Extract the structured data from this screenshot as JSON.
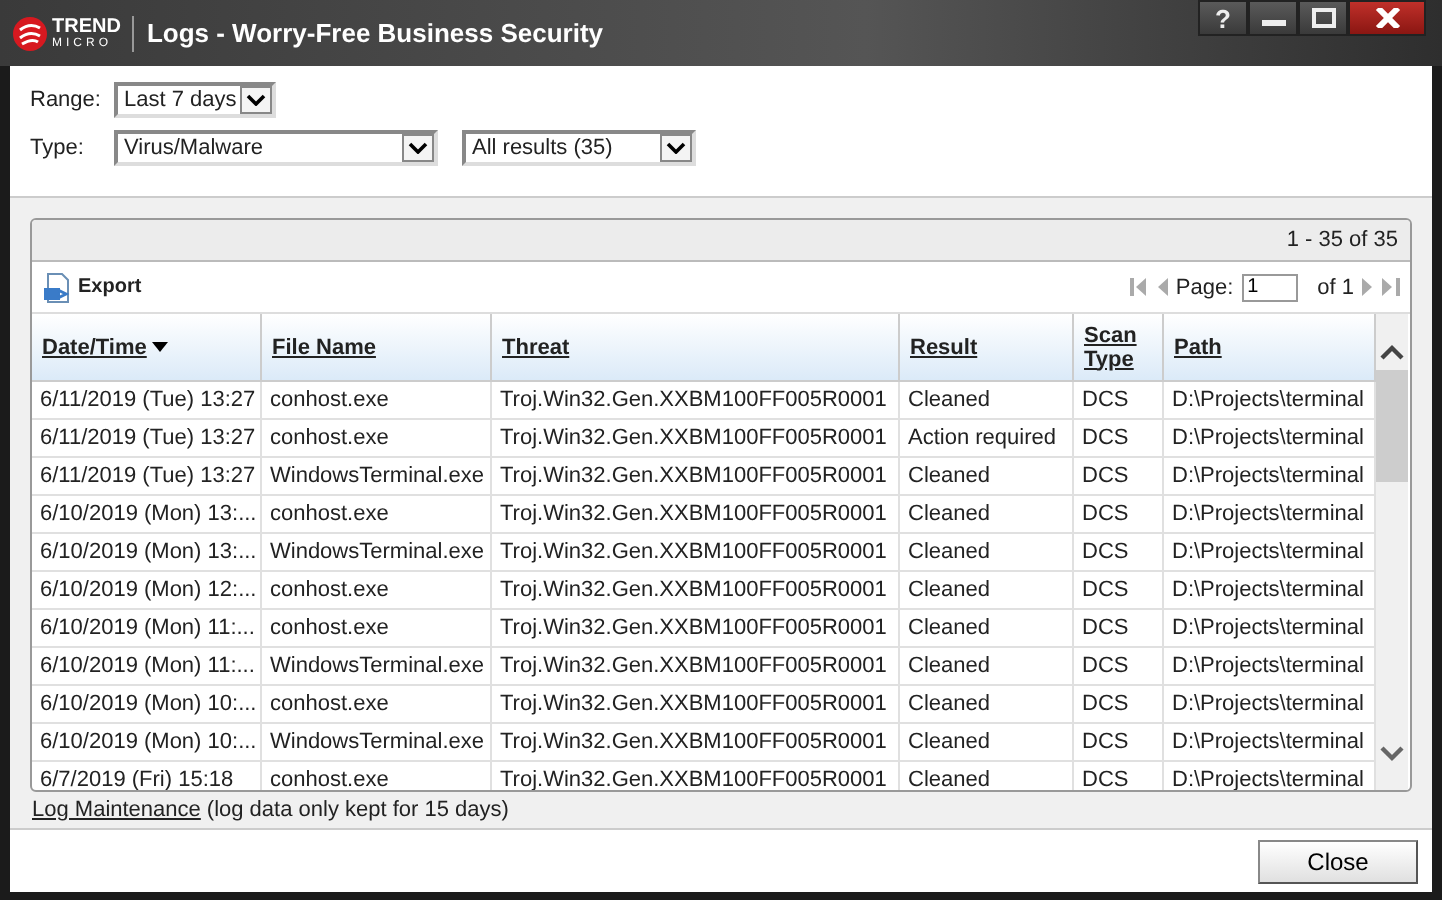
{
  "window": {
    "logo": {
      "line1": "TREND",
      "line2": "MICRO"
    },
    "title": "Logs - Worry-Free Business Security",
    "help": "?"
  },
  "filters": {
    "range": {
      "label": "Range:",
      "value": "Last 7 days"
    },
    "type": {
      "label": "Type:",
      "value": "Virus/Malware"
    },
    "results": {
      "value": "All results (35)"
    }
  },
  "table": {
    "count": "1 - 35 of 35",
    "export": "Export",
    "pager": {
      "label": "Page:",
      "value": "1",
      "of": "of 1"
    },
    "columns": [
      {
        "label": "Date/Time",
        "sorted": true
      },
      {
        "label": "File Name",
        "sorted": false
      },
      {
        "label": "Threat",
        "sorted": false
      },
      {
        "label": "Result",
        "sorted": false
      },
      {
        "label": "Scan Type",
        "sorted": false
      },
      {
        "label": "Path",
        "sorted": false
      }
    ],
    "rows": [
      [
        "6/11/2019 (Tue) 13:27",
        "conhost.exe",
        "Troj.Win32.Gen.XXBM100FF005R0001",
        "Cleaned",
        "DCS",
        "D:\\Projects\\terminal"
      ],
      [
        "6/11/2019 (Tue) 13:27",
        "conhost.exe",
        "Troj.Win32.Gen.XXBM100FF005R0001",
        "Action required",
        "DCS",
        "D:\\Projects\\terminal"
      ],
      [
        "6/11/2019 (Tue) 13:27",
        "WindowsTerminal.exe",
        "Troj.Win32.Gen.XXBM100FF005R0001",
        "Cleaned",
        "DCS",
        "D:\\Projects\\terminal"
      ],
      [
        "6/10/2019 (Mon) 13:...",
        "conhost.exe",
        "Troj.Win32.Gen.XXBM100FF005R0001",
        "Cleaned",
        "DCS",
        "D:\\Projects\\terminal"
      ],
      [
        "6/10/2019 (Mon) 13:...",
        "WindowsTerminal.exe",
        "Troj.Win32.Gen.XXBM100FF005R0001",
        "Cleaned",
        "DCS",
        "D:\\Projects\\terminal"
      ],
      [
        "6/10/2019 (Mon) 12:...",
        "conhost.exe",
        "Troj.Win32.Gen.XXBM100FF005R0001",
        "Cleaned",
        "DCS",
        "D:\\Projects\\terminal"
      ],
      [
        "6/10/2019 (Mon) 11:...",
        "conhost.exe",
        "Troj.Win32.Gen.XXBM100FF005R0001",
        "Cleaned",
        "DCS",
        "D:\\Projects\\terminal"
      ],
      [
        "6/10/2019 (Mon) 11:...",
        "WindowsTerminal.exe",
        "Troj.Win32.Gen.XXBM100FF005R0001",
        "Cleaned",
        "DCS",
        "D:\\Projects\\terminal"
      ],
      [
        "6/10/2019 (Mon) 10:...",
        "conhost.exe",
        "Troj.Win32.Gen.XXBM100FF005R0001",
        "Cleaned",
        "DCS",
        "D:\\Projects\\terminal"
      ],
      [
        "6/10/2019 (Mon) 10:...",
        "WindowsTerminal.exe",
        "Troj.Win32.Gen.XXBM100FF005R0001",
        "Cleaned",
        "DCS",
        "D:\\Projects\\terminal"
      ],
      [
        "6/7/2019 (Fri) 15:18",
        "conhost.exe",
        "Troj.Win32.Gen.XXBM100FF005R0001",
        "Cleaned",
        "DCS",
        "D:\\Projects\\terminal"
      ]
    ]
  },
  "maintenance": {
    "link": "Log Maintenance",
    "note": "(log data only kept for 15 days)"
  },
  "buttons": {
    "close": "Close"
  }
}
